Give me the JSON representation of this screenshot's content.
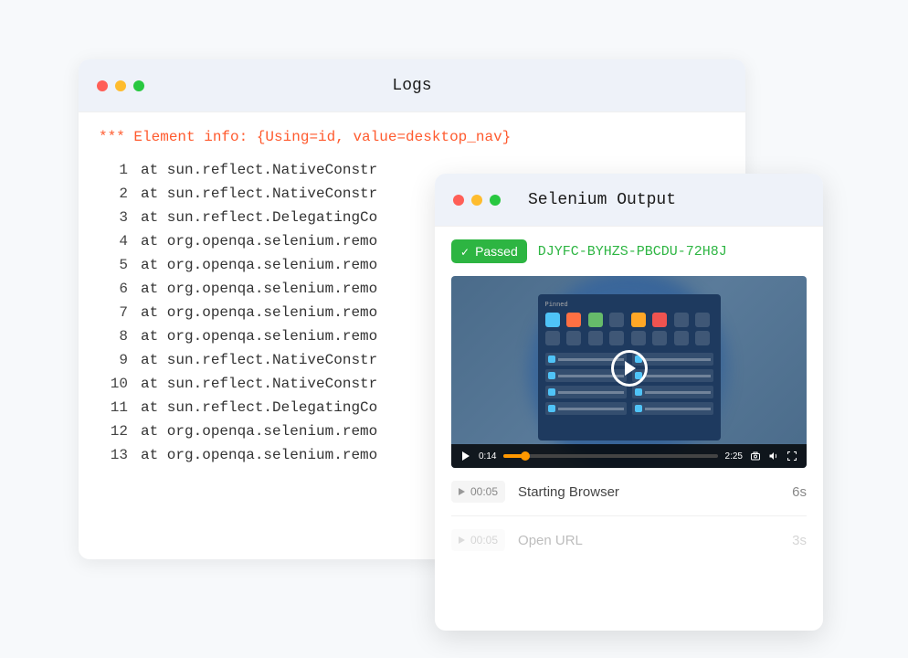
{
  "logs_window": {
    "title": "Logs",
    "element_info": "*** Element info: {Using=id, value=desktop_nav}",
    "lines": [
      "at sun.reflect.NativeConstr",
      "at sun.reflect.NativeConstr",
      "at sun.reflect.DelegatingCo",
      "at org.openqa.selenium.remo",
      "at org.openqa.selenium.remo",
      "at org.openqa.selenium.remo",
      "at org.openqa.selenium.remo",
      "at org.openqa.selenium.remo",
      "at sun.reflect.NativeConstr",
      "at sun.reflect.NativeConstr",
      "at sun.reflect.DelegatingCo",
      "at org.openqa.selenium.remo",
      "at org.openqa.selenium.remo"
    ]
  },
  "selenium_window": {
    "title": "Selenium Output",
    "status_label": "Passed",
    "test_id": "DJYFC-BYHZS-PBCDU-72H8J",
    "video": {
      "current_time": "0:14",
      "duration": "2:25",
      "desktop_label": "Pinned"
    },
    "steps": [
      {
        "time": "00:05",
        "label": "Starting Browser",
        "duration": "6s"
      },
      {
        "time": "00:05",
        "label": "Open URL",
        "duration": "3s"
      }
    ]
  }
}
